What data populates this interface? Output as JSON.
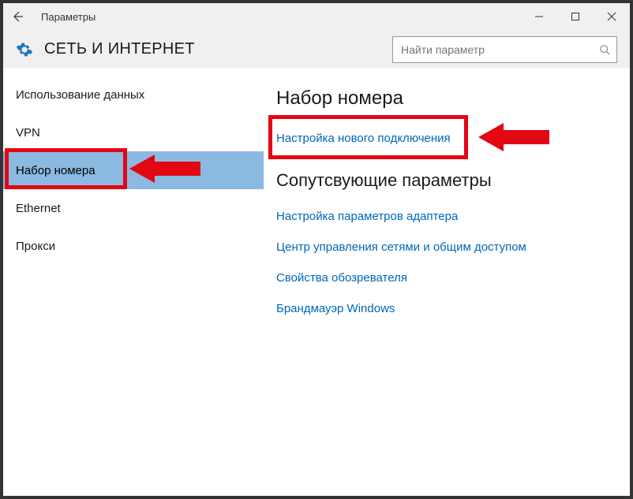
{
  "titlebar": {
    "title": "Параметры"
  },
  "header": {
    "title": "СЕТЬ И ИНТЕРНЕТ"
  },
  "search": {
    "placeholder": "Найти параметр"
  },
  "sidebar": {
    "items": [
      {
        "label": "Использование данных"
      },
      {
        "label": "VPN"
      },
      {
        "label": "Набор номера"
      },
      {
        "label": "Ethernet"
      },
      {
        "label": "Прокси"
      }
    ]
  },
  "content": {
    "heading": "Набор номера",
    "primary_link": "Настройка нового подключения",
    "subheading": "Сопутсвующие параметры",
    "related_links": [
      "Настройка параметров адаптера",
      "Центр управления сетями и общим доступом",
      "Свойства обозревателя",
      "Брандмауэр Windows"
    ]
  }
}
